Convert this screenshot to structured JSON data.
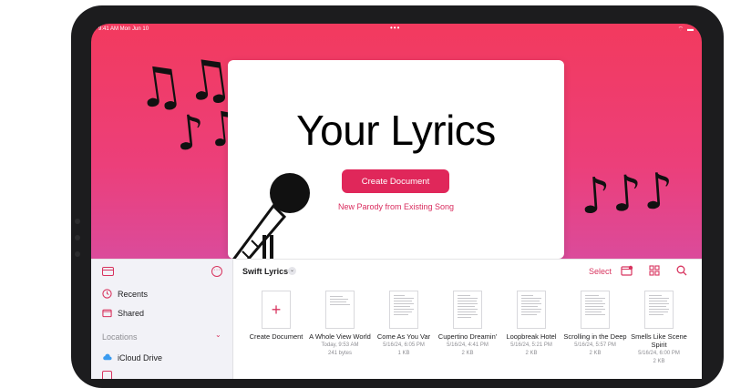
{
  "status_bar": {
    "time": "9:41 AM  Mon Jun 10",
    "dots": "•••",
    "right": "⌔ ▬"
  },
  "hero": {
    "title": "Your Lyrics",
    "create_button": "Create Document",
    "parody_link": "New Parody from Existing Song",
    "notes_left": "♫♫",
    "notes_left2": "♪♫",
    "notes_right": "♪♪♪"
  },
  "sidebar": {
    "recents": "Recents",
    "shared": "Shared",
    "locations_header": "Locations",
    "icloud": "iCloud Drive"
  },
  "toolbar": {
    "folder_title": "Swift Lyrics",
    "select": "Select"
  },
  "documents": [
    {
      "name": "Create Document",
      "meta1": "",
      "meta2": ""
    },
    {
      "name": "A Whole View World",
      "meta1": "Today, 9:53 AM",
      "meta2": "241 bytes"
    },
    {
      "name": "Come As You Var",
      "meta1": "5/16/24, 6:05 PM",
      "meta2": "1 KB"
    },
    {
      "name": "Cupertino Dreamin'",
      "meta1": "5/16/24, 4:41 PM",
      "meta2": "2 KB"
    },
    {
      "name": "Loopbreak Hotel",
      "meta1": "5/16/24, 5:21 PM",
      "meta2": "2 KB"
    },
    {
      "name": "Scrolling in the Deep",
      "meta1": "5/16/24, 5:57 PM",
      "meta2": "2 KB"
    },
    {
      "name": "Smells Like Scene Spirit",
      "meta1": "5/16/24, 6:00 PM",
      "meta2": "2 KB"
    }
  ],
  "colors": {
    "accent": "#d8345f",
    "button": "#e0275a",
    "gradient_top": "#f23a5e",
    "gradient_bottom": "#c85ab8"
  }
}
